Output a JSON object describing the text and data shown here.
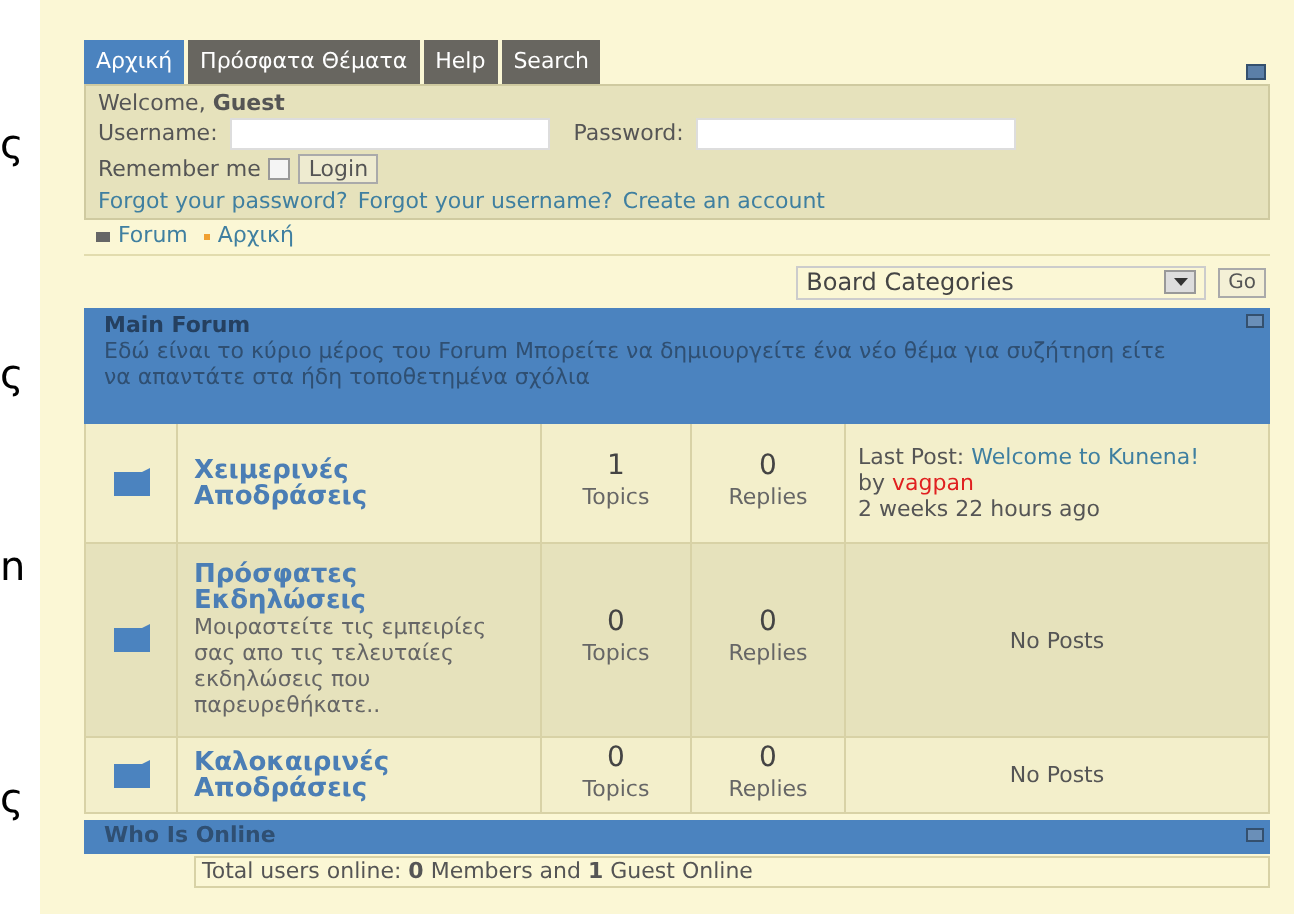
{
  "edge_fragments": [
    "ς",
    "ς",
    "n",
    "ς"
  ],
  "tabs": [
    {
      "label": "Αρχική",
      "selected": true
    },
    {
      "label": "Πρόσφατα Θέματα",
      "selected": false
    },
    {
      "label": "Help",
      "selected": false
    },
    {
      "label": "Search",
      "selected": false
    }
  ],
  "login": {
    "welcome": "Welcome, **Guest**",
    "username_label": "Username:",
    "password_label": "Password:",
    "remember_label": "Remember me",
    "remember_checked": false,
    "login_button": "Login",
    "links": [
      "Forgot your password?",
      "Forgot your username?",
      "Create an account"
    ]
  },
  "breadcrumb": [
    "Forum",
    "Αρχική"
  ],
  "category_select": {
    "value": "Board Categories",
    "go_button": "Go"
  },
  "category": {
    "title": "Main Forum",
    "description": "Εδώ είναι το κύριο μέρος του Forum Μπορείτε να δημιουργείτε ένα νέο θέμα για συζήτηση είτε να απαντάτε στα ήδη τοποθετημένα σχόλια"
  },
  "forums": [
    {
      "name": "Χειμερινές Αποδράσεις",
      "topics": "1",
      "topics_label": "Topics",
      "replies": "0",
      "replies_label": "Replies",
      "last_post": {
        "kind": "post",
        "label": "Last Post:",
        "title": "Welcome to Kunena!",
        "by": "by",
        "author": "vagpan",
        "time": "2 weeks 22 hours ago"
      }
    },
    {
      "name": "Πρόσφατες Εκδηλώσεις",
      "description": "Μοιραστείτε τις εμπειρίες σας απο τις τελευταίες εκδηλώσεις που παρευρεθήκατε..",
      "topics": "0",
      "topics_label": "Topics",
      "replies": "0",
      "replies_label": "Replies",
      "last_post": {
        "kind": "none",
        "text": "No Posts"
      }
    },
    {
      "name": "Καλοκαιρινές Αποδράσεις",
      "topics": "0",
      "topics_label": "Topics",
      "replies": "0",
      "replies_label": "Replies",
      "last_post": {
        "kind": "none",
        "text": "No Posts"
      }
    }
  ],
  "who_is_online": {
    "title": "Who Is Online",
    "summary": "Total users online: **0** Members and **1** Guest Online"
  }
}
